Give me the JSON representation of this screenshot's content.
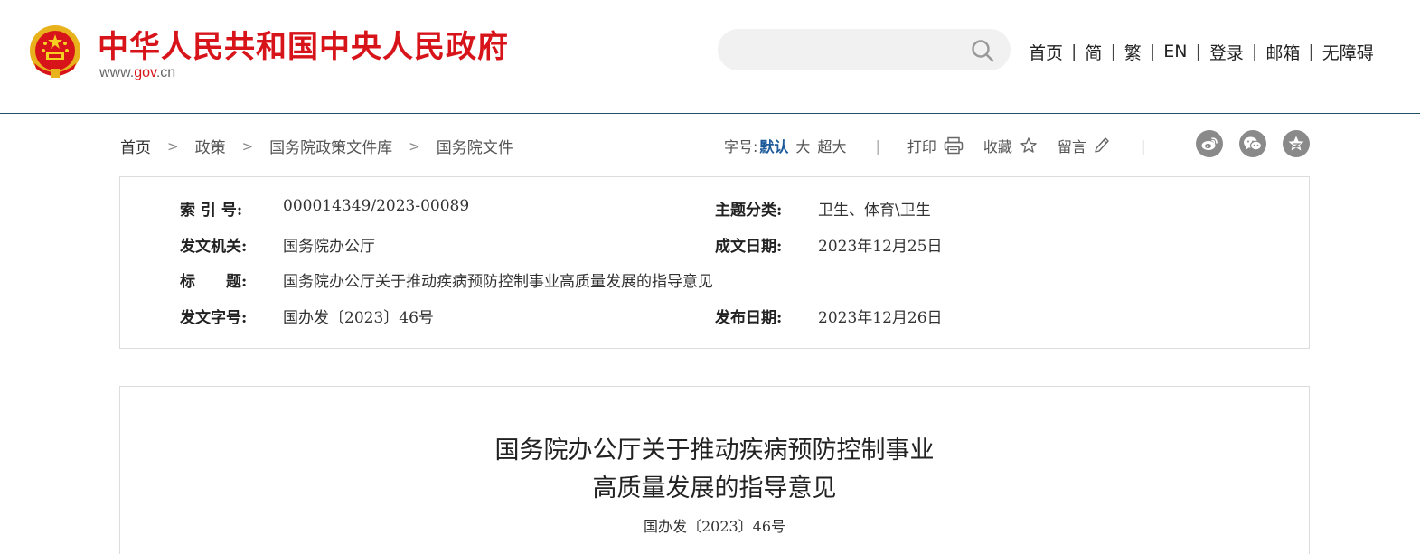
{
  "header": {
    "site_title": "中华人民共和国中央人民政府",
    "domain_prefix": "www.",
    "domain_mid": "gov",
    "domain_suffix": ".cn",
    "search_placeholder": "",
    "nav": [
      "首页",
      "简",
      "繁",
      "EN",
      "登录",
      "邮箱",
      "无障碍"
    ],
    "nav_separator": "|"
  },
  "breadcrumb": {
    "items": [
      "首页",
      "政策",
      "国务院政策文件库",
      "国务院文件"
    ],
    "separator": ">"
  },
  "tools": {
    "font_label": "字号:",
    "font_options": [
      "默认",
      "大",
      "超大"
    ],
    "separator": "|",
    "print": "打印",
    "favorite": "收藏",
    "comment": "留言"
  },
  "share": [
    "weibo-icon",
    "wechat-icon",
    "qzone-icon"
  ],
  "info": {
    "index_label": "索 引 号:",
    "index_value": "000014349/2023-00089",
    "topic_label": "主题分类:",
    "topic_value": "卫生、体育\\卫生",
    "issuer_label": "发文机关:",
    "issuer_value": "国务院办公厅",
    "written_label": "成文日期:",
    "written_value": "2023年12月25日",
    "title_label": "标　　题:",
    "title_value": "国务院办公厅关于推动疾病预防控制事业高质量发展的指导意见",
    "docno_label": "发文字号:",
    "docno_value": "国办发〔2023〕46号",
    "published_label": "发布日期:",
    "published_value": "2023年12月26日"
  },
  "article": {
    "title_line1": "国务院办公厅关于推动疾病预防控制事业",
    "title_line2": "高质量发展的指导意见",
    "doc_number": "国办发〔2023〕46号"
  },
  "colors": {
    "brand_red": "#d8141b",
    "accent_blue": "#1d5a9a",
    "header_rule": "#1f4f6a"
  }
}
